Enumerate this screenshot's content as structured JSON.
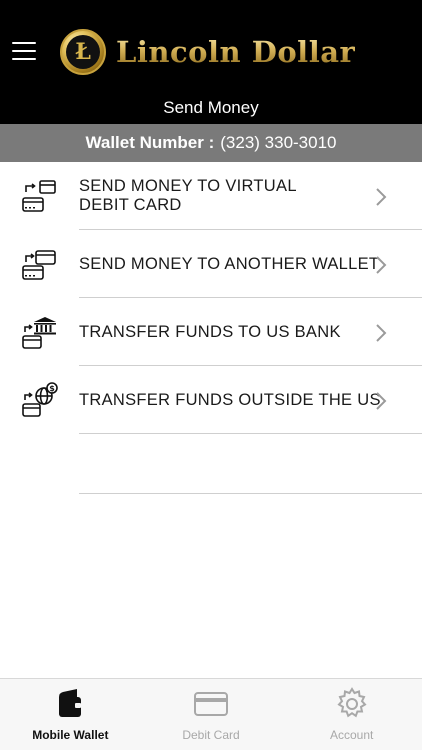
{
  "header": {
    "menu_icon": "hamburger-menu-icon",
    "logo_icon": "lincoln-dollar-coin-icon",
    "logo_text": "Lincoln Dollar",
    "page_title": "Send Money"
  },
  "wallet": {
    "label": "Wallet Number :",
    "number": "(323) 330-3010"
  },
  "options": [
    {
      "label_line1": "SEND MONEY TO VIRTUAL",
      "label_line2": "DEBIT CARD",
      "icon": "wallet-to-card-icon"
    },
    {
      "label_line1": "SEND MONEY TO ANOTHER WALLET",
      "label_line2": "",
      "icon": "wallet-to-wallet-icon"
    },
    {
      "label_line1": "TRANSFER FUNDS TO US BANK",
      "label_line2": "",
      "icon": "wallet-to-bank-icon"
    },
    {
      "label_line1": "TRANSFER FUNDS OUTSIDE THE US",
      "label_line2": "",
      "icon": "wallet-to-globe-icon"
    }
  ],
  "tabs": [
    {
      "label": "Mobile Wallet",
      "icon": "wallet-icon",
      "active": true
    },
    {
      "label": "Debit Card",
      "icon": "credit-card-icon",
      "active": false
    },
    {
      "label": "Account",
      "icon": "gear-icon",
      "active": false
    }
  ],
  "colors": {
    "header_bg": "#000000",
    "wallet_bar_bg": "#7a7a7a",
    "gold": "#d4b45a",
    "inactive_tab": "#a8a8a8"
  }
}
